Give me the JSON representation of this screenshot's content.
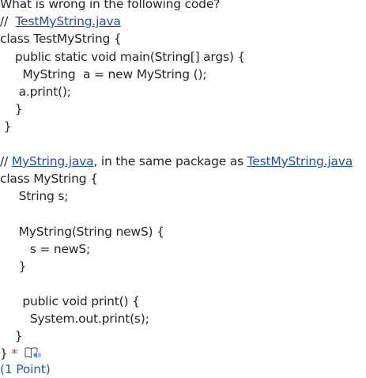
{
  "question": {
    "prompt": "What is wrong in the following code?",
    "file1_comment_prefix": "//  ",
    "file1_name": "TestMyString.java",
    "file1_lines": [
      "class TestMyString {",
      "    public static void main(String[] args) {",
      "      MyString  a = new MyString ();",
      "     a.print();",
      "    }",
      " }"
    ],
    "file2_comment_prefix": "// ",
    "file2_name": "MyString.java",
    "file2_comment_middle": ", in the same package as ",
    "file2_ref": "TestMyString.java",
    "file2_lines": [
      "class MyString {",
      "     String s;",
      "",
      "     MyString(String newS) {",
      "        s = newS;",
      "     }",
      "",
      "      public void print() {",
      "        System.out.print(s);",
      "    }",
      "}"
    ],
    "required_mark": "*",
    "points": "(1 Point)"
  },
  "icons": {
    "immersive_reader": "immersive-reader-icon"
  },
  "colors": {
    "text": "#262626",
    "link": "#1f4fb9",
    "required": "#c0392b",
    "points": "#2b5c9e"
  }
}
